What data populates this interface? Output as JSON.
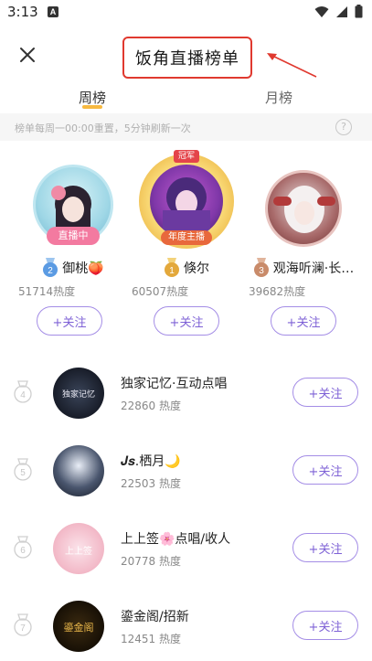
{
  "status_bar": {
    "time": "3:13",
    "notification_letter": "A"
  },
  "header": {
    "title": "饭角直播榜单"
  },
  "tabs": [
    {
      "label": "周榜",
      "active": true
    },
    {
      "label": "月榜",
      "active": false
    }
  ],
  "notice": {
    "text": "榜单每周一00:00重置，5分钟刷新一次",
    "help": "?"
  },
  "live_badge": "直播中",
  "crown_label": "冠军",
  "annual_label": "年度主播",
  "podium": [
    {
      "rank": 2,
      "name": "御桃🍑",
      "heat": "51714热度",
      "follow": "+关注",
      "medal_color": "#6aa8e8"
    },
    {
      "rank": 1,
      "name": "倏尔",
      "heat": "60507热度",
      "follow": "+关注",
      "medal_color": "#e8b34b"
    },
    {
      "rank": 3,
      "name": "观海听澜·长…",
      "heat": "39682热度",
      "follow": "+关注",
      "medal_color": "#c98b6a"
    }
  ],
  "list": [
    {
      "rank": 4,
      "name": "独家记忆·互动点唱",
      "heat": "22860 热度",
      "follow": "+关注",
      "avatar_text": "独家记忆"
    },
    {
      "rank": 5,
      "name": "𝑱𝒔.栖月🌙",
      "heat": "22503 热度",
      "follow": "+关注",
      "avatar_text": ""
    },
    {
      "rank": 6,
      "name": "上上签🌸点唱/收人",
      "heat": "20778 热度",
      "follow": "+关注",
      "avatar_text": "上上签"
    },
    {
      "rank": 7,
      "name": "鎏金阁/招新",
      "heat": "12451 热度",
      "follow": "+关注",
      "avatar_text": "鎏金阁"
    }
  ],
  "colors": {
    "accent": "#7e61d6",
    "title_border": "#e0392f",
    "tab_underline": "#f7b940"
  }
}
